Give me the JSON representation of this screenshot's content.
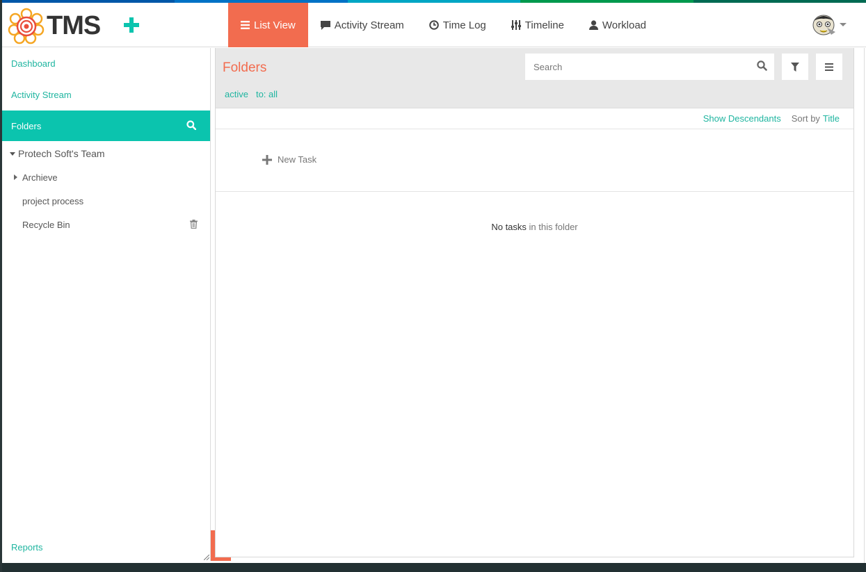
{
  "app": {
    "logo_text": "TMS"
  },
  "colors": {
    "accent": "#f26c4f",
    "teal": "#0bc4ae",
    "link": "#1fb5a0",
    "strip": [
      "#0057a8",
      "#0072c6",
      "#00a6c4",
      "#00994d",
      "#006a52"
    ]
  },
  "nav": [
    {
      "label": "List View",
      "icon": "list-icon",
      "active": true
    },
    {
      "label": "Activity Stream",
      "icon": "comment-icon",
      "active": false
    },
    {
      "label": "Time Log",
      "icon": "clock-icon",
      "active": false
    },
    {
      "label": "Timeline",
      "icon": "sliders-icon",
      "active": false
    },
    {
      "label": "Workload",
      "icon": "user-icon",
      "active": false
    }
  ],
  "sidebar": {
    "dashboard": "Dashboard",
    "activity_stream": "Activity Stream",
    "folders": "Folders",
    "team": "Protech Soft's Team",
    "items": [
      {
        "label": "Archieve"
      },
      {
        "label": "project process"
      },
      {
        "label": "Recycle Bin"
      }
    ],
    "reports": "Reports"
  },
  "main": {
    "title": "Folders",
    "search_placeholder": "Search",
    "filters": [
      "active",
      "to: all"
    ],
    "show_descendants": "Show Descendants",
    "sort_label": "Sort by",
    "sort_value": "Title",
    "new_task": "New Task",
    "empty_strong": "No tasks",
    "empty_rest": "in this folder"
  }
}
